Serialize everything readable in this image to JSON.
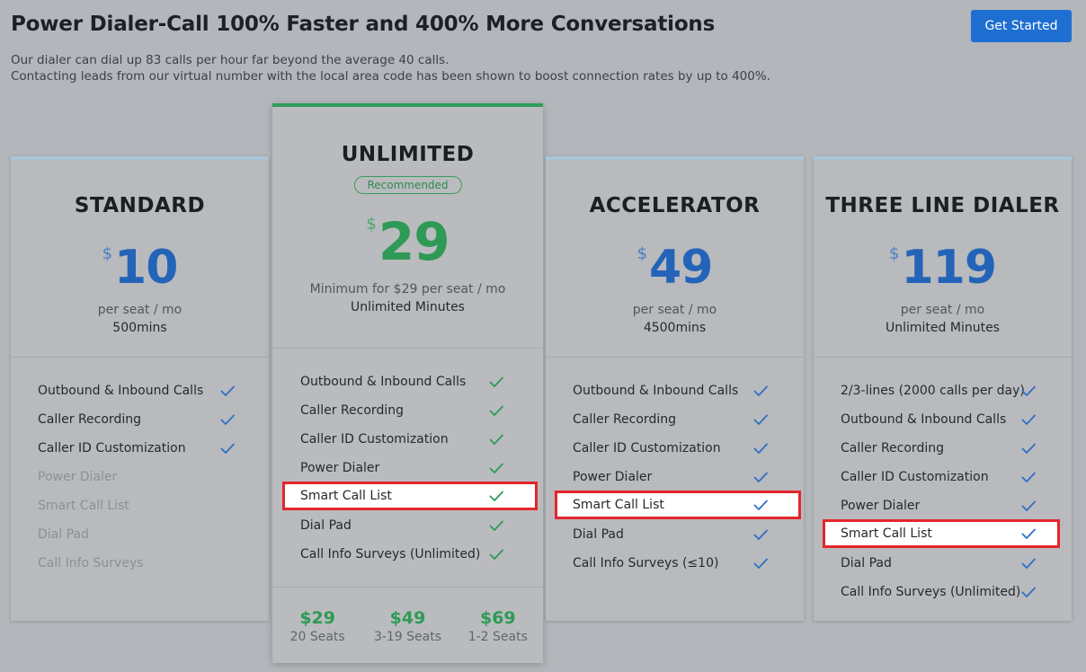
{
  "header": {
    "title": "Power Dialer-Call 100% Faster and 400% More Conversations",
    "subtitle_line1": "Our dialer can dial up 83 calls per hour far beyond the average 40 calls.",
    "subtitle_line2": "Contacting leads from our virtual number with the local area code has been shown to boost connection rates by up to 400%.",
    "cta_label": "Get Started"
  },
  "colors": {
    "accent_blue": "#1e6fd1",
    "price_blue": "#2464b8",
    "price_green": "#2e9a55",
    "highlight_red": "#e3262b"
  },
  "plans": [
    {
      "name": "STANDARD",
      "currency": "$",
      "price": "10",
      "per": "per seat / mo",
      "minutes": "500mins",
      "features": [
        {
          "label": "Outbound & Inbound Calls",
          "included": true
        },
        {
          "label": "Caller Recording",
          "included": true
        },
        {
          "label": "Caller ID Customization",
          "included": true
        },
        {
          "label": "Power Dialer",
          "included": false
        },
        {
          "label": "Smart Call List",
          "included": false
        },
        {
          "label": "Dial Pad",
          "included": false
        },
        {
          "label": "Call Info Surveys",
          "included": false
        }
      ]
    },
    {
      "name": "UNLIMITED",
      "badge": "Recommended",
      "currency": "$",
      "price": "29",
      "per": "Minimum for $29 per seat / mo",
      "minutes": "Unlimited Minutes",
      "features": [
        {
          "label": "Outbound & Inbound Calls",
          "included": true
        },
        {
          "label": "Caller Recording",
          "included": true
        },
        {
          "label": "Caller ID Customization",
          "included": true
        },
        {
          "label": "Power Dialer",
          "included": true
        },
        {
          "label": "Smart Call List",
          "included": true,
          "highlighted": true
        },
        {
          "label": "Dial Pad",
          "included": true
        },
        {
          "label": "Call Info Surveys (Unlimited)",
          "included": true
        }
      ],
      "seat_tiers": [
        {
          "price": "$29",
          "seats": "20 Seats"
        },
        {
          "price": "$49",
          "seats": "3-19 Seats"
        },
        {
          "price": "$69",
          "seats": "1-2 Seats"
        }
      ]
    },
    {
      "name": "ACCELERATOR",
      "currency": "$",
      "price": "49",
      "per": "per seat / mo",
      "minutes": "4500mins",
      "features": [
        {
          "label": "Outbound & Inbound Calls",
          "included": true
        },
        {
          "label": "Caller Recording",
          "included": true
        },
        {
          "label": "Caller ID Customization",
          "included": true
        },
        {
          "label": "Power Dialer",
          "included": true
        },
        {
          "label": "Smart Call List",
          "included": true,
          "highlighted": true
        },
        {
          "label": "Dial Pad",
          "included": true
        },
        {
          "label": "Call Info Surveys (≤10)",
          "included": true
        }
      ]
    },
    {
      "name": "THREE LINE DIALER",
      "currency": "$",
      "price": "119",
      "per": "per seat / mo",
      "minutes": "Unlimited Minutes",
      "features": [
        {
          "label": "2/3-lines (2000 calls per day)",
          "included": true
        },
        {
          "label": "Outbound & Inbound Calls",
          "included": true
        },
        {
          "label": "Caller Recording",
          "included": true
        },
        {
          "label": "Caller ID Customization",
          "included": true
        },
        {
          "label": "Power Dialer",
          "included": true
        },
        {
          "label": "Smart Call List",
          "included": true,
          "highlighted": true
        },
        {
          "label": "Dial Pad",
          "included": true
        },
        {
          "label": "Call Info Surveys (Unlimited)",
          "included": true
        }
      ]
    }
  ]
}
